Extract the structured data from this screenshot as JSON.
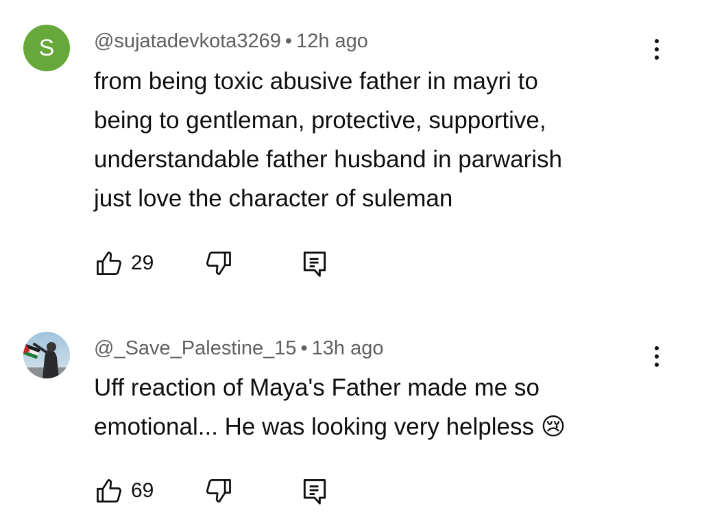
{
  "comments": [
    {
      "avatar_letter": "S",
      "avatar_color": "#67a83a",
      "author": "@sujatadevkota3269",
      "separator": "•",
      "time": "12h ago",
      "lines": [
        "from being  toxic abusive father in mayri to",
        "being to gentleman, protective, supportive,",
        "understandable father husband in parwarish",
        "just love the character of suleman"
      ],
      "likes": "29",
      "icons": [
        "thumbs-up-icon",
        "thumbs-down-icon",
        "reply-icon",
        "more-vert-icon"
      ]
    },
    {
      "avatar_letter": "",
      "author": "@_Save_Palestine_15",
      "separator": "•",
      "time": "13h ago",
      "lines": [
        "Uff reaction of Maya's Father made me so",
        "emotional... He was looking very helpless 😢"
      ],
      "likes": "69",
      "icons": [
        "thumbs-up-icon",
        "thumbs-down-icon",
        "reply-icon",
        "more-vert-icon"
      ]
    }
  ],
  "colors": {
    "text": "#0f0f0f",
    "meta": "#606060",
    "background": "#ffffff"
  }
}
